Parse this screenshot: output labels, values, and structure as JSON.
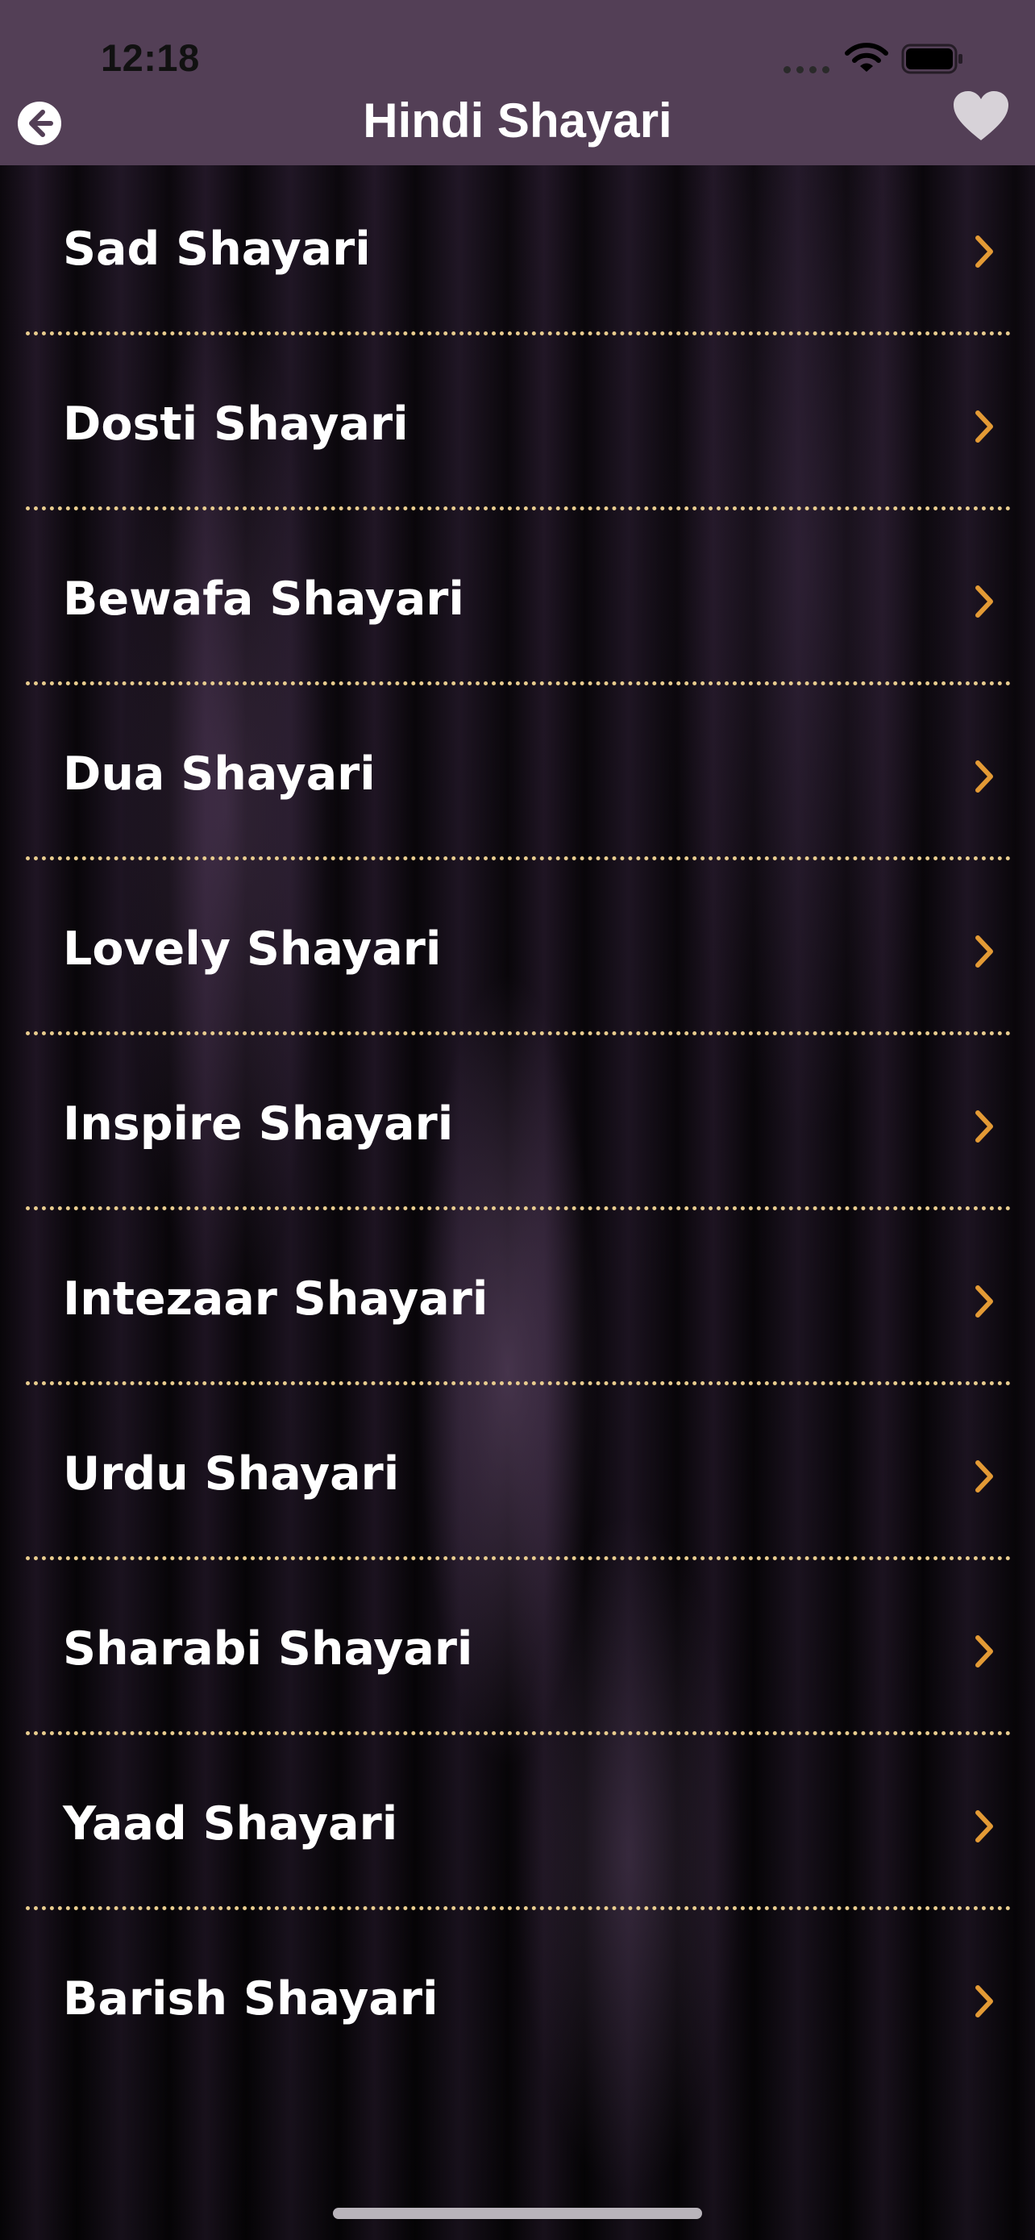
{
  "status_bar": {
    "time": "12:18"
  },
  "nav": {
    "title": "Hindi Shayari",
    "back_icon": "back-arrow-circle-icon",
    "favorite_icon": "heart-icon"
  },
  "categories": [
    {
      "label": "Sad Shayari"
    },
    {
      "label": "Dosti Shayari"
    },
    {
      "label": "Bewafa Shayari"
    },
    {
      "label": "Dua Shayari"
    },
    {
      "label": "Lovely Shayari"
    },
    {
      "label": "Inspire Shayari"
    },
    {
      "label": "Intezaar Shayari"
    },
    {
      "label": "Urdu Shayari"
    },
    {
      "label": "Sharabi Shayari"
    },
    {
      "label": "Yaad Shayari"
    },
    {
      "label": "Barish Shayari"
    }
  ],
  "colors": {
    "nav_bar": "#533f56",
    "chevron": "#e39a35",
    "divider": "#e8cc8e",
    "text": "#ffffff"
  }
}
